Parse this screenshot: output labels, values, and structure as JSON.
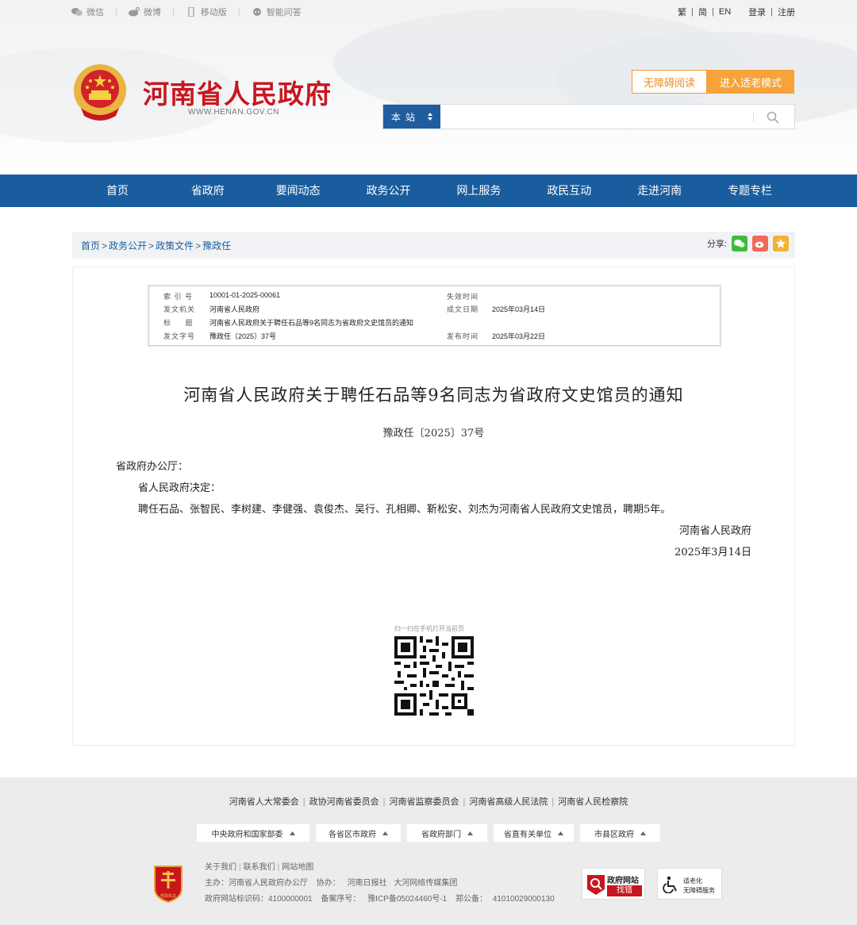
{
  "topbar": {
    "links": [
      {
        "icon": "wechat-icon",
        "label": "微信"
      },
      {
        "icon": "weibo-icon",
        "label": "微博"
      },
      {
        "icon": "mobile-icon",
        "label": "移动版"
      },
      {
        "icon": "robot-icon",
        "label": "智能问答"
      }
    ],
    "lang": {
      "traditional": "繁",
      "simplified": "简",
      "english": "EN",
      "login": "登录",
      "register": "注册"
    }
  },
  "header": {
    "site_name": "河南省人民政府",
    "site_url": "WWW.HENAN.GOV.CN",
    "accessible_label": "无障碍阅读",
    "elder_label": "进入适老模式",
    "search_scope": "本站",
    "search_placeholder": ""
  },
  "nav": [
    "首页",
    "省政府",
    "要闻动态",
    "政务公开",
    "网上服务",
    "政民互动",
    "走进河南",
    "专题专栏"
  ],
  "breadcrumb": {
    "items": [
      "首页",
      "政务公开",
      "政策文件",
      "豫政任"
    ],
    "share_label": "分享:"
  },
  "meta": {
    "index_label": "索 引 号",
    "index_value": "10001-01-2025-00061",
    "expiry_label": "失效时间",
    "expiry_value": "",
    "issuer_label": "发文机关",
    "issuer_value": "河南省人民政府",
    "date_label": "成文日期",
    "date_value": "2025年03月14日",
    "title_label": "标     题",
    "title_value": "河南省人民政府关于聘任石品等9名同志为省政府文史馆员的通知",
    "docno_label": "发文字号",
    "docno_value": "豫政任〔2025〕37号",
    "publish_label": "发布时间",
    "publish_value": "2025年03月22日"
  },
  "document": {
    "title": "河南省人民政府关于聘任石品等9名同志为省政府文史馆员的通知",
    "number": "豫政任〔2025〕37号",
    "salutation": "省政府办公厅：",
    "para1": "省人民政府决定：",
    "para2": "聘任石品、张智民、李树建、李健强、袁俊杰、吴行、孔相卿、靳松安、刘杰为河南省人民政府文史馆员，聘期5年。",
    "signature": "河南省人民政府",
    "date": "2025年3月14日",
    "qr_caption": "扫一扫在手机打开当前页"
  },
  "footer": {
    "links": [
      "河南省人大常委会",
      "政协河南省委员会",
      "河南省监察委员会",
      "河南省高级人民法院",
      "河南省人民检察院"
    ],
    "dropdowns": [
      "中央政府和国家部委",
      "各省区市政府",
      "省政府部门",
      "省直有关单位",
      "市县区政府"
    ],
    "info_links": [
      "关于我们",
      "联系我们",
      "网站地图"
    ],
    "host": "主办：河南省人民政府办公厅",
    "cohost": "协办：",
    "cohost_1": "河南日报社",
    "cohost_2": "大河网络传媒集团",
    "site_id": "政府网站标识码：4100000001",
    "icp": "备案序号：",
    "icp_value": "豫ICP备05024460号-1",
    "police": "郑公备：",
    "police_value": "41010029000130",
    "emblem_text": "党政机关",
    "error_badge_title": "政府网站",
    "error_badge_sub": "找错",
    "aging_badge_title": "适老化",
    "aging_badge_sub": "无障碍服务"
  },
  "colors": {
    "brand_red": "#c8161d",
    "nav_blue": "#1a5d9e",
    "orange": "#f7a33a"
  }
}
